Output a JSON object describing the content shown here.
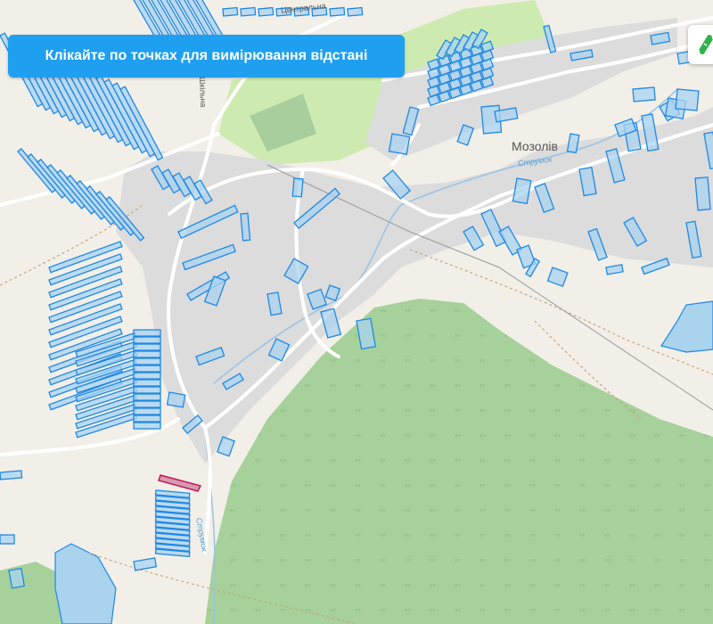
{
  "banner": {
    "text": "Клікайте по точках для вимірювання відстані"
  },
  "tool_button": {
    "icon": "measure-ruler-icon",
    "color": "#2eb34a"
  },
  "labels": {
    "village": "Мозолів",
    "street": "Шкільна",
    "stream": "Струмок",
    "stream_south": "Струмок",
    "street_top": "Центральна"
  },
  "colors": {
    "background": "#f2efe9",
    "forest": "#a6d19a",
    "meadow": "#cdebb0",
    "settlement": "#dcdcdc",
    "parcel_fill": "#a9d3f0",
    "parcel_stroke": "#1e88e5",
    "water": "#aad3ee",
    "road": "#ffffff",
    "highlight_parcel": "#c2185b"
  }
}
